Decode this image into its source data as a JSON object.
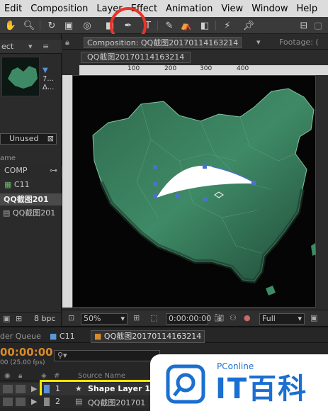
{
  "menu": [
    "Edit",
    "Composition",
    "Layer",
    "Effect",
    "Animation",
    "View",
    "Window",
    "Help"
  ],
  "project": {
    "tab": "ect",
    "thumb_info": [
      "7...",
      "Δ..."
    ],
    "unused_label": "Unused",
    "name_header": "ame",
    "items": [
      {
        "label": "COMP",
        "type": "folder"
      },
      {
        "label": "C11",
        "type": "comp"
      },
      {
        "label": "QQ截图201",
        "type": "comp"
      },
      {
        "label": "QQ截图201",
        "type": "image"
      }
    ],
    "bpc": "8 bpc"
  },
  "composition": {
    "tab_label": "Composition: QQ截图20170114163214",
    "footage_tab": "Footage: (",
    "subtab": "QQ截图20170114163214",
    "ruler_ticks": [
      "100",
      "200",
      "300",
      "400"
    ],
    "zoom": "50%",
    "timecode": "0:00:00:00",
    "resolution": "Full"
  },
  "timeline": {
    "tabs": [
      "der Queue",
      "C11",
      "QQ截图20170114163214"
    ],
    "current_time": "00:00:00",
    "fps": "00 (25.00 fps)",
    "col_hash": "#",
    "col_source": "Source Name",
    "layers": [
      {
        "num": "1",
        "name": "Shape Layer 1"
      },
      {
        "num": "2",
        "name": "QQ截图201701"
      }
    ]
  },
  "watermark": {
    "brand": "PConline",
    "logo_text": "IT百科"
  },
  "colors": {
    "annotation_red": "#e8352a",
    "highlight_yellow": "#f2e600",
    "accent_orange": "#d88a2a",
    "map_green": "#3d7a5c"
  }
}
